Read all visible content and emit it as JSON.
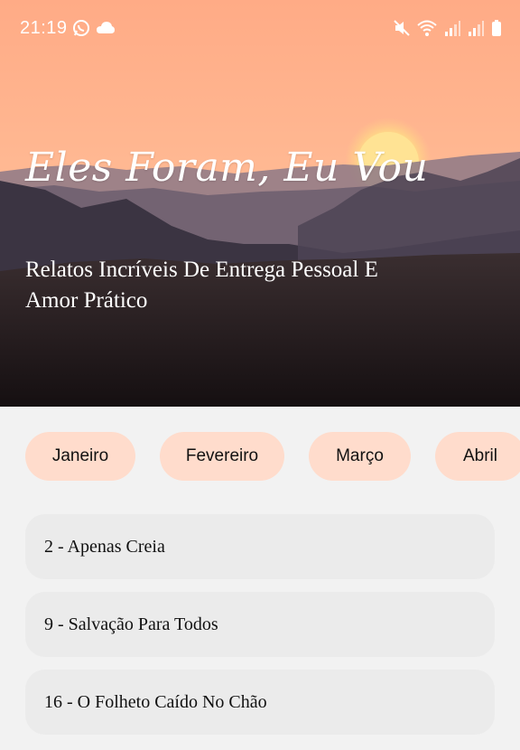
{
  "status_bar": {
    "time": "21:19",
    "left_icons": [
      "whatsapp-icon",
      "cloud-icon"
    ],
    "right_icons": [
      "mute-vibrate-icon",
      "wifi-icon",
      "signal-icon",
      "signal-icon",
      "battery-icon"
    ]
  },
  "hero": {
    "title": "Eles Foram, Eu Vou",
    "subtitle": "Relatos Incríveis De Entrega Pessoal E Amor Prático"
  },
  "tabs": [
    {
      "label": "Janeiro"
    },
    {
      "label": "Fevereiro"
    },
    {
      "label": "Março"
    },
    {
      "label": "Abril"
    }
  ],
  "entries": [
    {
      "label": "2 - Apenas Creia"
    },
    {
      "label": "9 - Salvação Para Todos"
    },
    {
      "label": "16 - O Folheto Caído No Chão"
    }
  ],
  "colors": {
    "tab_background": "#ffdccc",
    "card_background": "#ebebeb",
    "page_background": "#f2f2f2"
  }
}
